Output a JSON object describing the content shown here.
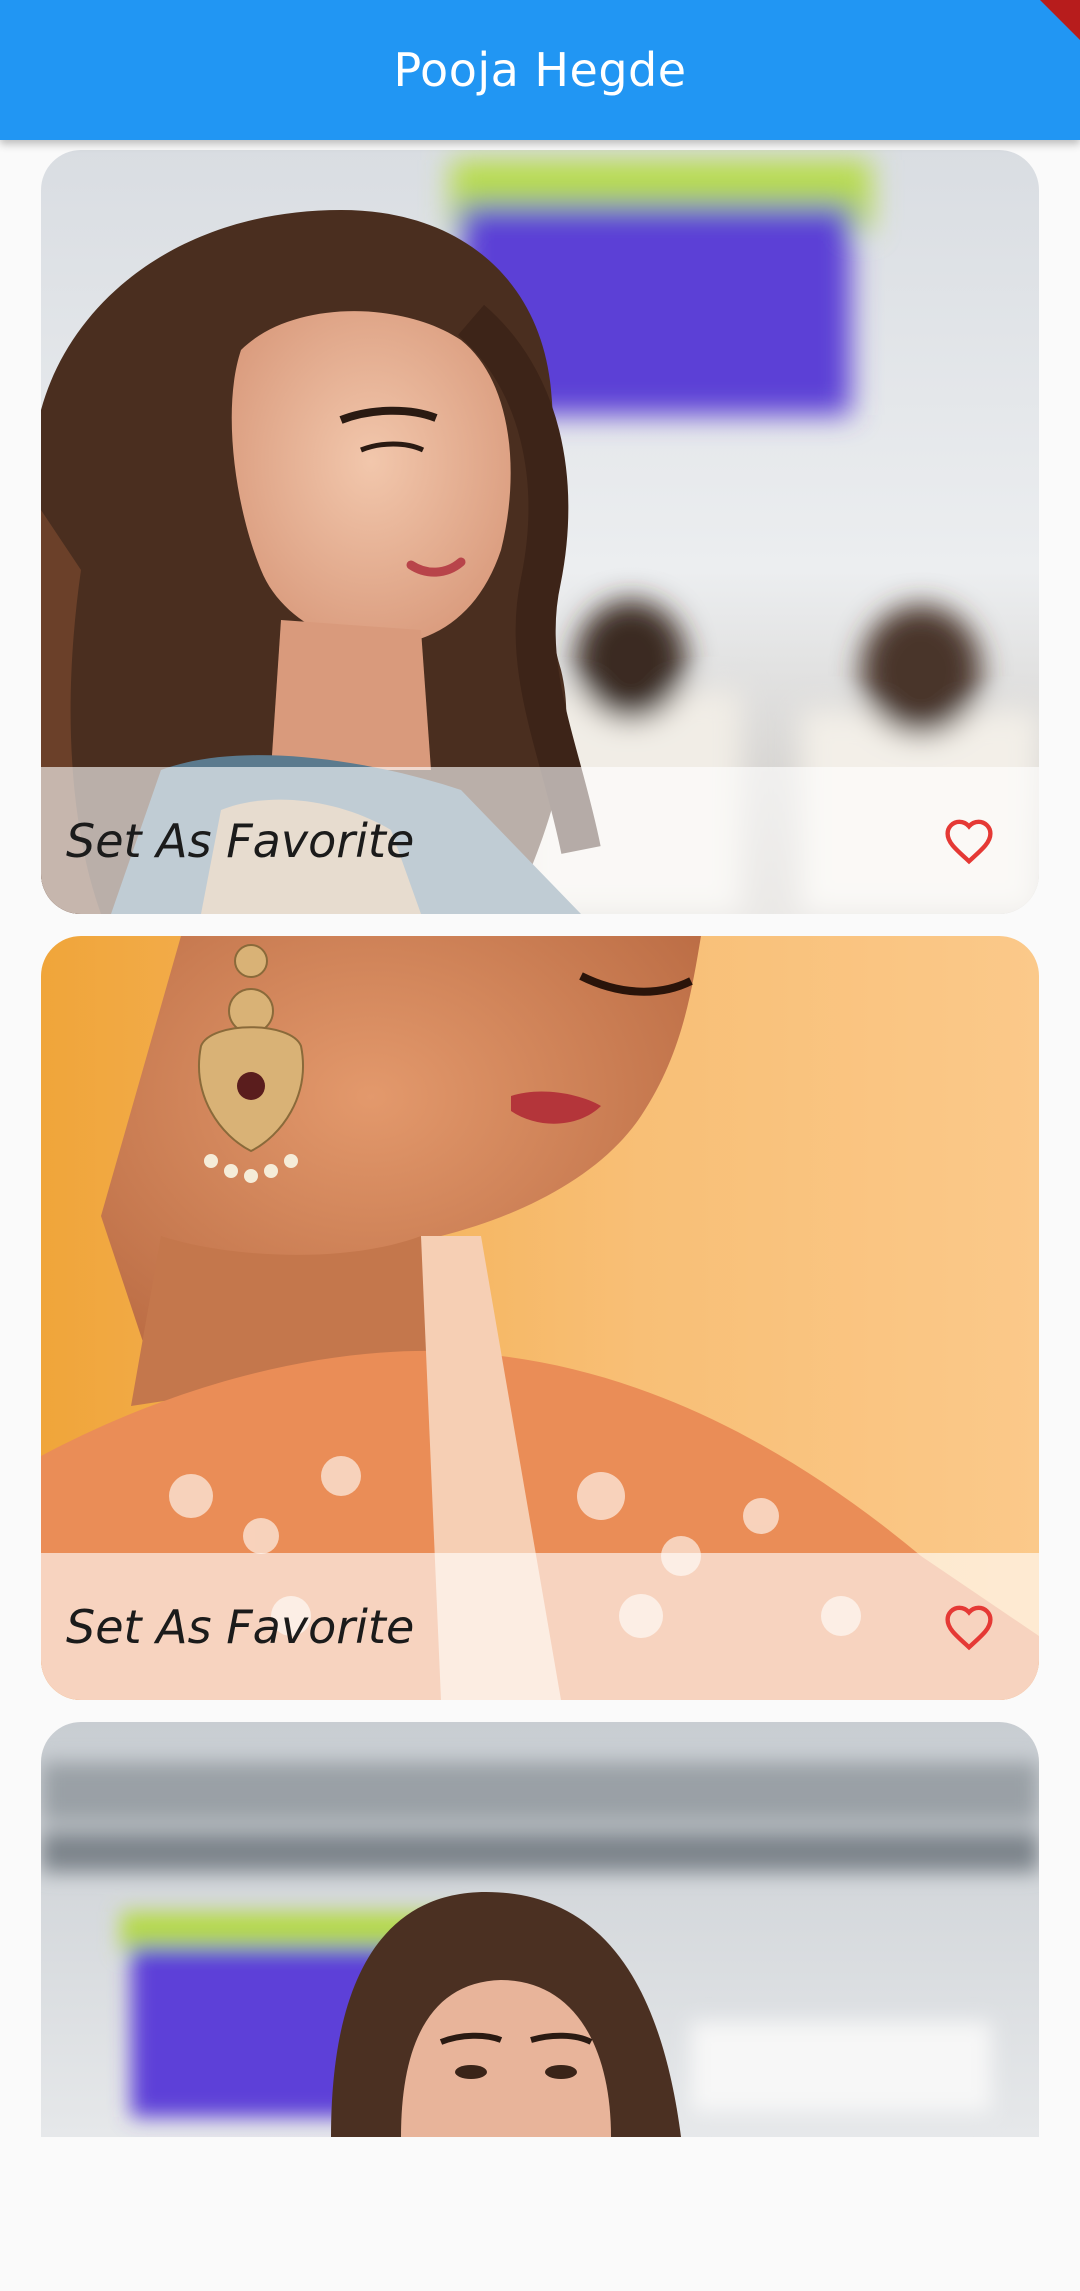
{
  "app_bar": {
    "title": "Pooja Hegde"
  },
  "colors": {
    "primary": "#2196f3",
    "heart": "#e53935",
    "background": "#fafafa"
  },
  "cards": [
    {
      "favorite_label": "Set As Favorite",
      "icon": "heart-outline-icon"
    },
    {
      "favorite_label": "Set As Favorite",
      "icon": "heart-outline-icon"
    },
    {
      "favorite_label": "",
      "icon": ""
    }
  ]
}
